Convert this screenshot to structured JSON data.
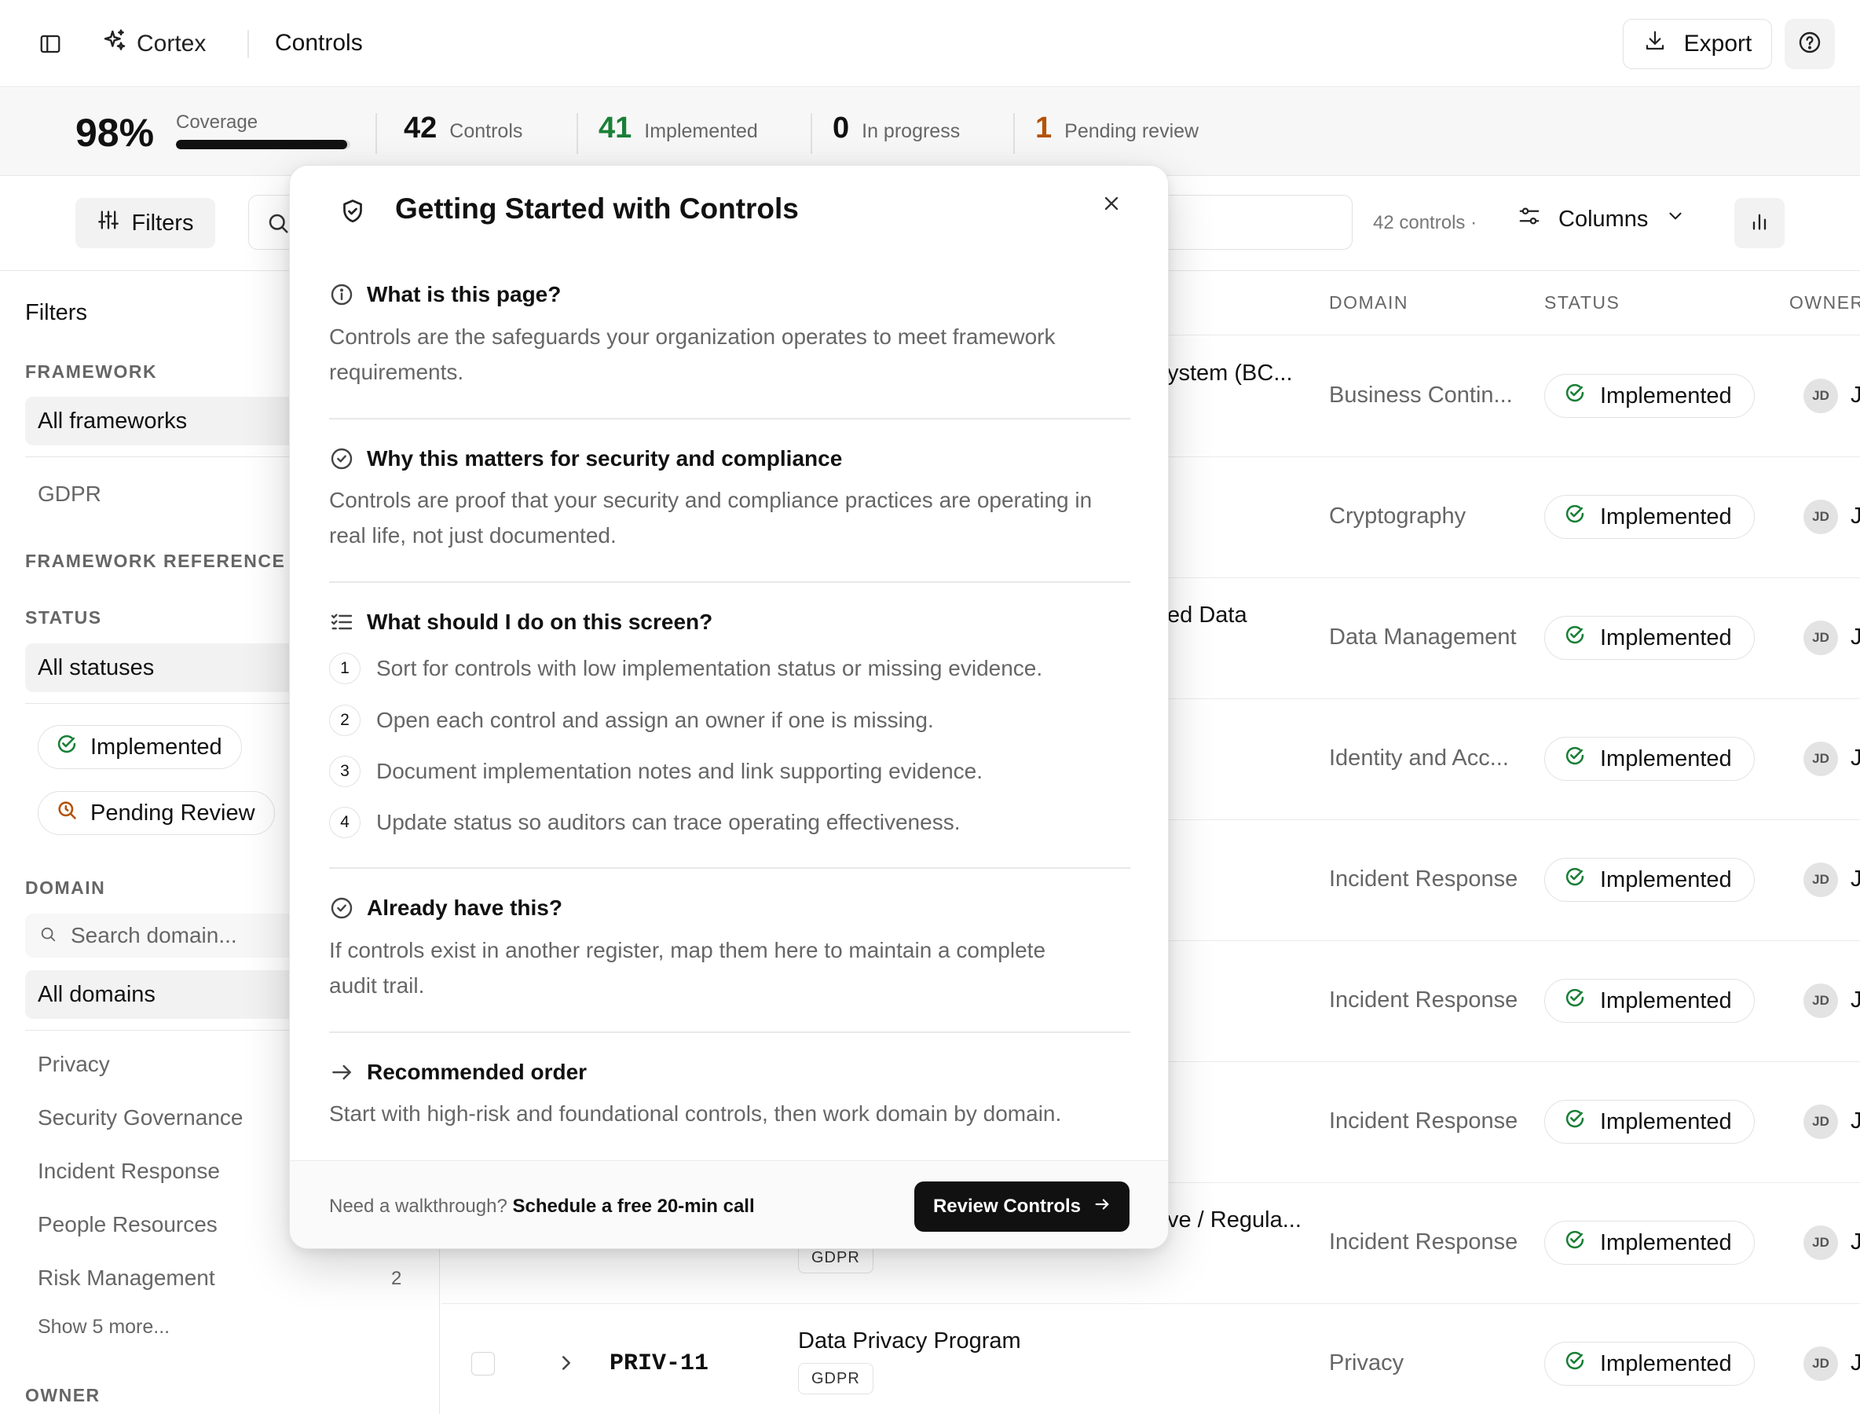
{
  "header": {
    "brand": "Cortex",
    "page_title": "Controls",
    "export_label": "Export"
  },
  "stats": {
    "coverage_pct": "98%",
    "coverage_label": "Coverage",
    "coverage_fraction": 0.98,
    "controls_count": "42",
    "controls_label": "Controls",
    "implemented_count": "41",
    "implemented_label": "Implemented",
    "in_progress_count": "0",
    "in_progress_label": "In progress",
    "pending_count": "1",
    "pending_label": "Pending review",
    "colors": {
      "implemented": "#1a7f37",
      "pending": "#b45309"
    }
  },
  "toolbar": {
    "filters_label": "Filters",
    "count_text": "42 controls  ·",
    "columns_label": "Columns"
  },
  "sidebar": {
    "title": "Filters",
    "framework_heading": "FRAMEWORK",
    "framework_selected": "All frameworks",
    "framework_options": [
      "GDPR"
    ],
    "framework_reference_heading": "FRAMEWORK REFERENCE",
    "status_heading": "STATUS",
    "status_selected": "All statuses",
    "status_chips": [
      "Implemented",
      "Pending Review"
    ],
    "domain_heading": "DOMAIN",
    "domain_search_placeholder": "Search domain...",
    "domain_selected": "All domains",
    "domain_items": [
      {
        "label": "Privacy",
        "count": ""
      },
      {
        "label": "Security Governance",
        "count": ""
      },
      {
        "label": "Incident Response",
        "count": ""
      },
      {
        "label": "People Resources",
        "count": ""
      },
      {
        "label": "Risk Management",
        "count": "2"
      }
    ],
    "show_more": "Show 5 more...",
    "owner_heading": "OWNER"
  },
  "table": {
    "headers": {
      "domain": "DOMAIN",
      "status": "STATUS",
      "owner": "OWNER"
    },
    "rows": [
      {
        "name": "ystem (BC...",
        "domain": "Business Contin...",
        "status": "Implemented",
        "owner_initials": "JD"
      },
      {
        "name": "",
        "domain": "Cryptography",
        "status": "Implemented",
        "owner_initials": "JD"
      },
      {
        "name": "ed Data",
        "domain": "Data Management",
        "status": "Implemented",
        "owner_initials": "JD"
      },
      {
        "name": "",
        "domain": "Identity and Acc...",
        "status": "Implemented",
        "owner_initials": "JD"
      },
      {
        "name": "",
        "domain": "Incident Response",
        "status": "Implemented",
        "owner_initials": "JD"
      },
      {
        "name": "",
        "domain": "Incident Response",
        "status": "Implemented",
        "owner_initials": "JD"
      },
      {
        "name": "",
        "domain": "Incident Response",
        "status": "Implemented",
        "owner_initials": "JD"
      },
      {
        "name": "ve / Regula...",
        "domain": "Incident Response",
        "status": "Implemented",
        "owner_initials": "JD",
        "framework": "GDPR"
      },
      {
        "code": "PRIV-11",
        "name": "Data Privacy Program",
        "domain": "Privacy",
        "status": "Implemented",
        "owner_initials": "JD",
        "framework": "GDPR"
      }
    ],
    "owner_trunc": "J"
  },
  "modal": {
    "title": "Getting Started with Controls",
    "sections": {
      "what": {
        "title": "What is this page?",
        "line1": "Controls are the safeguards your organization operates to meet framework",
        "line2": "requirements."
      },
      "why": {
        "title": "Why this matters for security and compliance",
        "line1": "Controls are proof that your security and compliance practices are operating in",
        "line2": "real life, not just documented."
      },
      "todo": {
        "title": "What should I do on this screen?",
        "steps": [
          {
            "num": "1",
            "text": "Sort for controls with low implementation status or missing evidence."
          },
          {
            "num": "2",
            "text": "Open each control and assign an owner if one is missing."
          },
          {
            "num": "3",
            "text": "Document implementation notes and link supporting evidence."
          },
          {
            "num": "4",
            "text": "Update status so auditors can trace operating effectiveness."
          }
        ]
      },
      "already": {
        "title": "Already have this?",
        "line1": "If controls exist in another register, map them here to maintain a complete",
        "line2": "audit trail."
      },
      "order": {
        "title": "Recommended order",
        "line1": "Start with high-risk and foundational controls, then work domain by domain."
      }
    },
    "footer": {
      "prompt": "Need a walkthrough?",
      "link": "Schedule a free 20-min call",
      "cta": "Review Controls"
    }
  }
}
